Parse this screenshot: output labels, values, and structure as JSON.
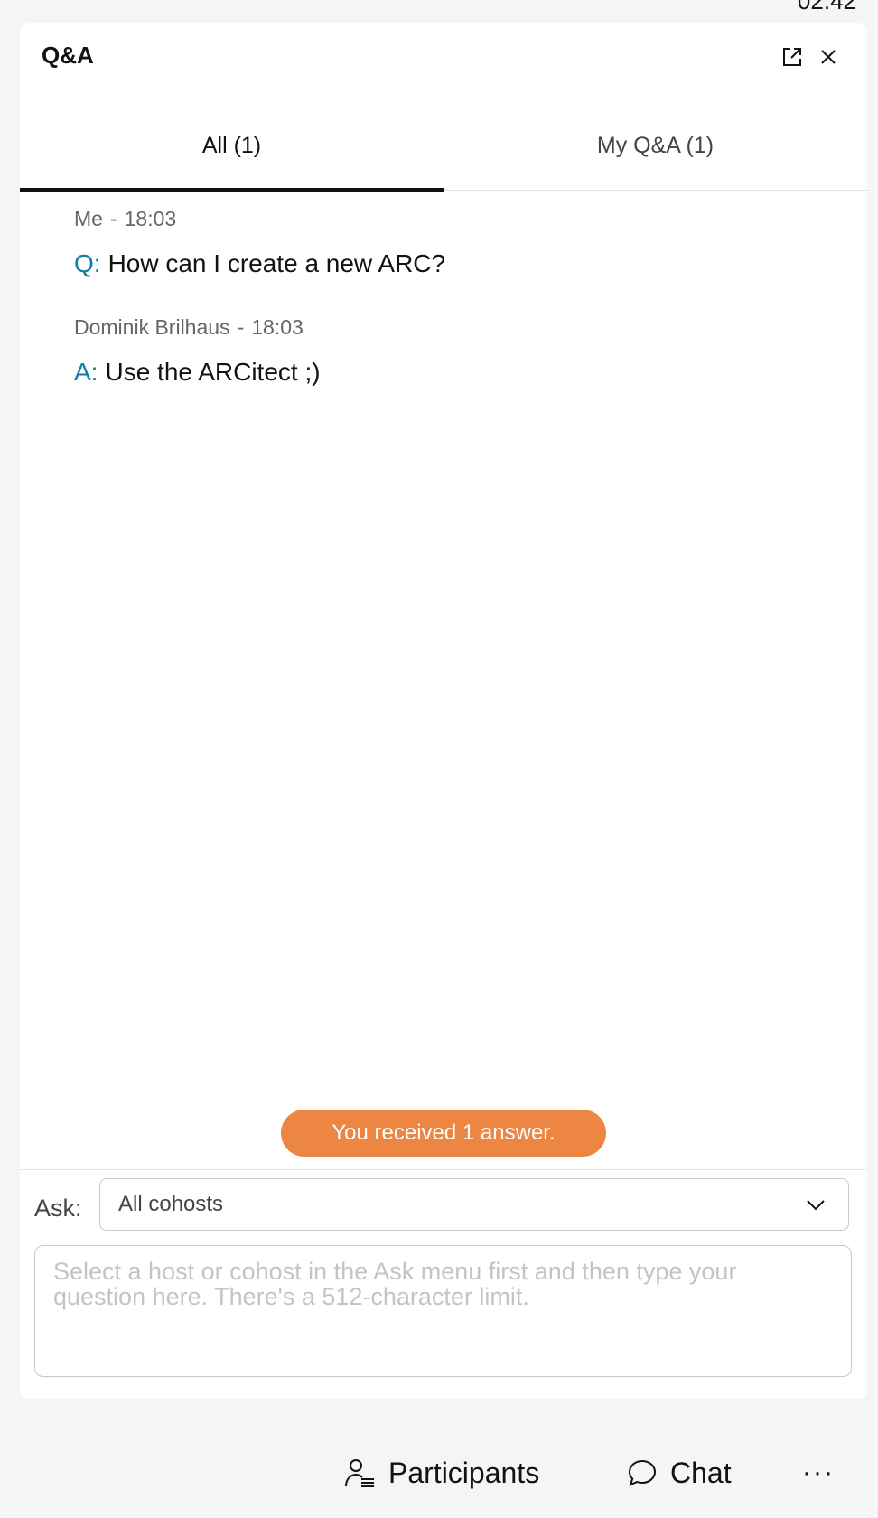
{
  "status_bar": {
    "time": "02:42"
  },
  "panel": {
    "title": "Q&A",
    "popout_icon": "popout-icon",
    "close_icon": "close-icon"
  },
  "tabs": [
    {
      "label": "All (1)",
      "active": true
    },
    {
      "label": "My Q&A (1)",
      "active": false
    }
  ],
  "messages": [
    {
      "author": "Me",
      "time": "18:03",
      "prefix": "Q:",
      "text": "How can I create a new ARC?"
    },
    {
      "author": "Dominik Brilhaus",
      "time": "18:03",
      "prefix": "A:",
      "text": "Use the ARCitect ;)"
    }
  ],
  "meta_separator": "-",
  "toast": {
    "text": "You received 1 answer.",
    "color": "#ed8643"
  },
  "ask": {
    "label": "Ask:",
    "selected": "All cohosts",
    "question_value": "",
    "question_placeholder": "Select a host or cohost in the Ask menu first and then type your question here. There's a 512-character limit."
  },
  "bottom_bar": {
    "participants_label": "Participants",
    "chat_label": "Chat",
    "more_label": "···"
  },
  "colors": {
    "accent": "#0a7fa7",
    "toast": "#ed8643"
  }
}
